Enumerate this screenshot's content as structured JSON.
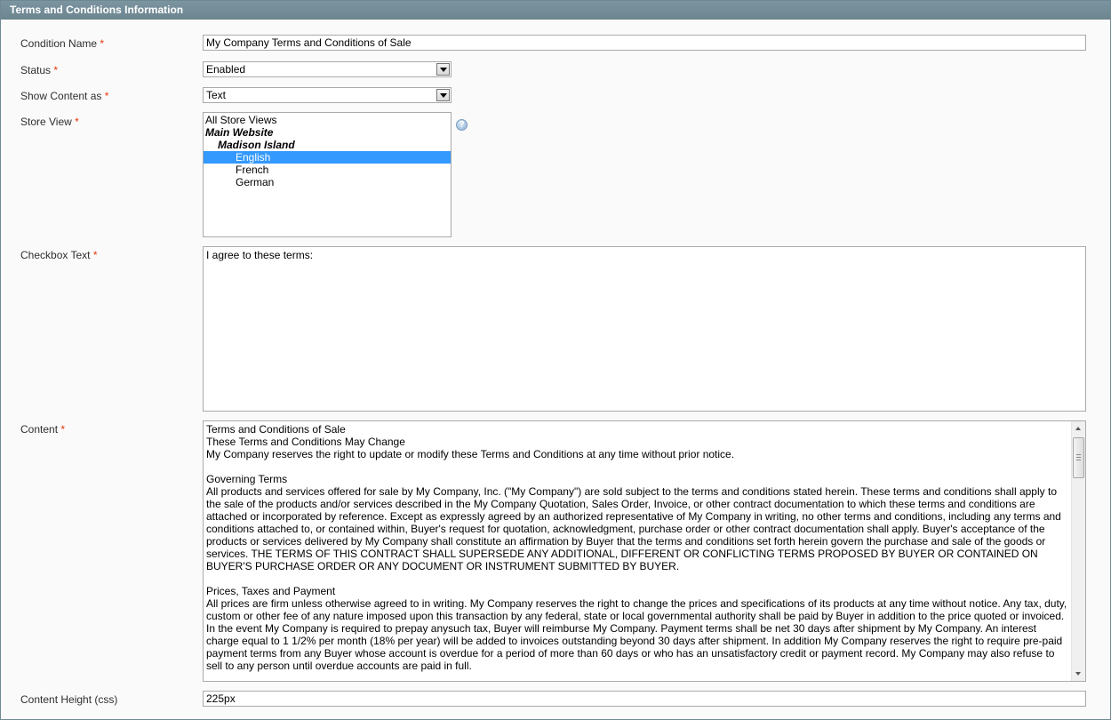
{
  "section_title": "Terms and Conditions Information",
  "fields": {
    "condition_name": {
      "label": "Condition Name",
      "required": "*",
      "value": "My Company Terms and Conditions of Sale"
    },
    "status": {
      "label": "Status",
      "required": "*",
      "value": "Enabled"
    },
    "show_content_as": {
      "label": "Show Content as",
      "required": "*",
      "value": "Text"
    },
    "store_view": {
      "label": "Store View",
      "required": "*",
      "options": [
        {
          "text": "All Store Views",
          "kind": "option",
          "selected": false
        },
        {
          "text": "Main Website",
          "kind": "group",
          "selected": false
        },
        {
          "text": "Madison Island",
          "kind": "group",
          "selected": false
        },
        {
          "text": "English",
          "kind": "option",
          "selected": true
        },
        {
          "text": "French",
          "kind": "option",
          "selected": false
        },
        {
          "text": "German",
          "kind": "option",
          "selected": false
        }
      ]
    },
    "checkbox_text": {
      "label": "Checkbox Text",
      "required": "*",
      "value": "I agree to these terms:"
    },
    "content": {
      "label": "Content",
      "required": "*",
      "value": "Terms and Conditions of Sale\nThese Terms and Conditions May Change\nMy Company reserves the right to update or modify these Terms and Conditions at any time without prior notice.\n\nGoverning Terms\nAll products and services offered for sale by My Company, Inc. (\"My Company\") are sold subject to the terms and conditions stated herein. These terms and conditions shall apply to the sale of the products and/or services described in the My Company Quotation, Sales Order, Invoice, or other contract documentation to which these terms and conditions are attached or incorporated by reference. Except as expressly agreed by an authorized representative of My Company in writing, no other terms and conditions, including any terms and conditions attached to, or contained within, Buyer's request for quotation, acknowledgment, purchase order or other contract documentation shall apply. Buyer's acceptance of the products or services delivered by My Company shall constitute an affirmation by Buyer that the terms and conditions set forth herein govern the purchase and sale of the goods or services. THE TERMS OF THIS CONTRACT SHALL SUPERSEDE ANY ADDITIONAL, DIFFERENT OR CONFLICTING TERMS PROPOSED BY BUYER OR CONTAINED ON BUYER'S PURCHASE ORDER OR ANY DOCUMENT OR INSTRUMENT SUBMITTED BY BUYER.\n\nPrices, Taxes and Payment\nAll prices are firm unless otherwise agreed to in writing. My Company reserves the right to change the prices and specifications of its products at any time without notice. Any tax, duty, custom or other fee of any nature imposed upon this transaction by any federal, state or local governmental authority shall be paid by Buyer in addition to the price quoted or invoiced. In the event My Company is required to prepay anysuch tax, Buyer will reimburse My Company. Payment terms shall be net 30 days after shipment by My Company. An interest charge equal to 1 1/2% per month (18% per year) will be added to invoices outstanding beyond 30 days after shipment. In addition My Company reserves the right to require pre-paid payment terms from any Buyer whose account is overdue for a period of more than 60 days or who has an unsatisfactory credit or payment record. My Company may also refuse to sell to any person until overdue accounts are paid in full."
    },
    "content_height": {
      "label": "Content Height (css)",
      "value": "225px"
    }
  },
  "icons": {
    "help": "help-icon"
  },
  "colors": {
    "header_bg": "#6f8992",
    "required": "#eb340a",
    "selected_option": "#3399ff"
  }
}
